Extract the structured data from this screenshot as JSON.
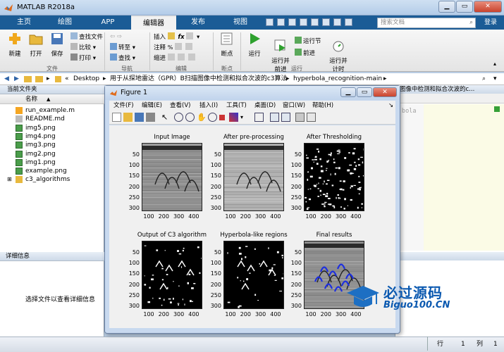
{
  "window": {
    "title": "MATLAB R2018a",
    "min": "▁",
    "max": "▭",
    "close": "✕"
  },
  "tabs": [
    {
      "label": "主页"
    },
    {
      "label": "绘图"
    },
    {
      "label": "APP"
    },
    {
      "label": "编辑器"
    },
    {
      "label": "发布"
    },
    {
      "label": "视图"
    }
  ],
  "search": {
    "placeholder": "搜索文档"
  },
  "login": "登录",
  "ribbon": {
    "new": "新建",
    "open": "打开",
    "save": "保存",
    "find_files": "查找文件",
    "compare": "比较",
    "print": "打印",
    "file_group": "文件",
    "goto": "转至",
    "find": "查找",
    "nav_group": "导航",
    "insert": "插入",
    "comment": "注释",
    "indent": "缩进",
    "edit_group": "编辑",
    "breakpoints": "断点",
    "bp_group": "断点",
    "run": "运行",
    "run_advance": "运行并\n前进",
    "run_section": "运行节",
    "advance": "前进",
    "run_time": "运行并\n计时",
    "run_group": "运行"
  },
  "address": {
    "parts": [
      "Desktop",
      "用于从探地雷达（GPR）B扫描图像中检测和拟合次波的c3算法",
      "hyperbola_recognition-main"
    ]
  },
  "file_panel": {
    "title": "当前文件夹",
    "col_name": "名称",
    "sort": "▲",
    "files": [
      {
        "name": "run_example.m",
        "type": "m"
      },
      {
        "name": "README.md",
        "type": "md"
      },
      {
        "name": "img5.png",
        "type": "png"
      },
      {
        "name": "img4.png",
        "type": "png"
      },
      {
        "name": "img3.png",
        "type": "png"
      },
      {
        "name": "img2.png",
        "type": "png"
      },
      {
        "name": "img1.png",
        "type": "png"
      },
      {
        "name": "example.png",
        "type": "png"
      },
      {
        "name": "c3_algorithms",
        "type": "folder"
      }
    ]
  },
  "details": {
    "title": "详细信息",
    "placeholder": "选择文件以查看详细信息"
  },
  "editor_tab": "图像中检测和拟合次波的c...",
  "editor_snippet": "bola",
  "figure": {
    "title": "Figure 1",
    "menu": [
      "文件(F)",
      "编辑(E)",
      "查看(V)",
      "插入(I)",
      "工具(T)",
      "桌面(D)",
      "窗口(W)",
      "帮助(H)"
    ],
    "plots": [
      {
        "title": "Input Image"
      },
      {
        "title": "After pre-processing"
      },
      {
        "title": "After Thresholding"
      },
      {
        "title": "Output of C3 algorithm"
      },
      {
        "title": "Hyperbola-like regions"
      },
      {
        "title": "Final results"
      }
    ],
    "yticks": [
      "50",
      "100",
      "150",
      "200",
      "250",
      "300"
    ],
    "xticks": [
      "100",
      "200",
      "300",
      "400"
    ]
  },
  "status": {
    "row_label": "行",
    "row": "1",
    "col_label": "列",
    "col": "1"
  },
  "watermark": {
    "line1": "必过源码",
    "line2": "Biguo100.CN"
  },
  "colors": {
    "ribbon_blue": "#1b5c96",
    "run_green": "#2ea12e",
    "accent": "#0a63b6"
  }
}
